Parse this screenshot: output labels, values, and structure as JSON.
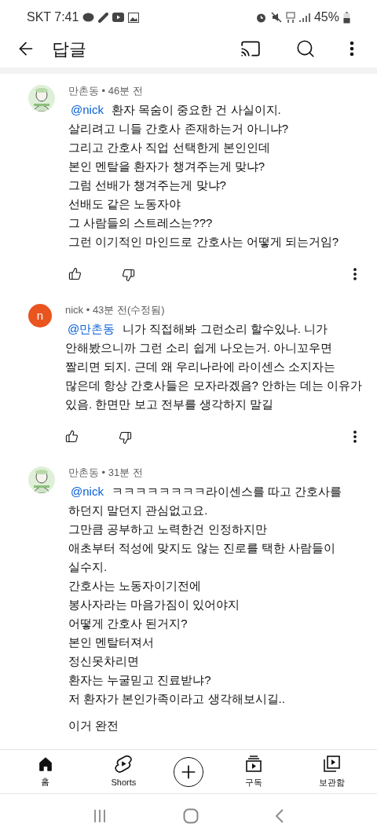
{
  "status_bar": {
    "carrier_time": "SKT 7:41",
    "battery": "45%"
  },
  "header": {
    "title": "답글"
  },
  "comments": [
    {
      "author": "만촌동",
      "meta": " • 46분 전",
      "avatar": {
        "kind": "picture"
      },
      "mention": "@nick",
      "paragraphs": [
        [
          "환자 목숨이 중요한 건 사실이지.",
          "살리려고 니들 간호사 존재하는거 아니냐?",
          "그리고 간호사 직업 선택한게 본인인데",
          "본인 멘탈을 환자가 챙겨주는게 맞냐?",
          "그럼 선배가 챙겨주는게 맞냐?",
          "선배도 같은 노동자야",
          "그 사람들의 스트레스는???",
          "그런 이기적인 마인드로 간호사는 어떻게 되는거임?"
        ]
      ],
      "actions": true
    },
    {
      "author": "nick",
      "meta": " • 43분 전(수정됨)",
      "avatar": {
        "kind": "letter",
        "letter": "n",
        "color": "#e9541f"
      },
      "mention": "@만촌동",
      "paragraphs": [
        [
          "니가 직접해봐 그런소리 할수있나. 니가",
          "안해봤으니까 그런 소리 쉽게 나오는거. 아니꼬우면",
          "짤리면 되지. 근데 왜 우리나라에 라이센스 소지자는",
          "많은데 항상 간호사들은 모자라겠음? 안하는 데는 이유가",
          "있음. 한면만 보고 전부를 생각하지 말길"
        ]
      ],
      "actions": true
    },
    {
      "author": "만촌동",
      "meta": " • 31분 전",
      "avatar": {
        "kind": "picture"
      },
      "mention": "@nick",
      "paragraphs": [
        [
          "ㅋㅋㅋㅋㅋㅋㅋㅋ라이센스를 따고 간호사를",
          "하던지 말던지 관심없고요.",
          "그만큼 공부하고 노력한건 인정하지만",
          "애초부터 적성에 맞지도 않는 진로를 택한 사람들이",
          "실수지.",
          "간호사는 노동자이기전에",
          "봉사자라는 마음가짐이 있어야지",
          "어떻게 간호사 된거지?",
          "본인 멘탈터져서",
          "정신못차리면",
          "환자는 누굴믿고 진료받냐?",
          "저 환자가 본인가족이라고 생각해보시길.."
        ],
        [
          "이거 완전"
        ]
      ],
      "actions": false
    }
  ],
  "bottom_nav": [
    {
      "kind": "home",
      "label": "홈",
      "selected": true
    },
    {
      "kind": "shorts",
      "label": "Shorts",
      "selected": false
    },
    {
      "kind": "create",
      "selected": false
    },
    {
      "kind": "subscriptions",
      "label": "구독",
      "selected": false
    },
    {
      "kind": "library",
      "label": "보관함",
      "selected": false
    }
  ]
}
